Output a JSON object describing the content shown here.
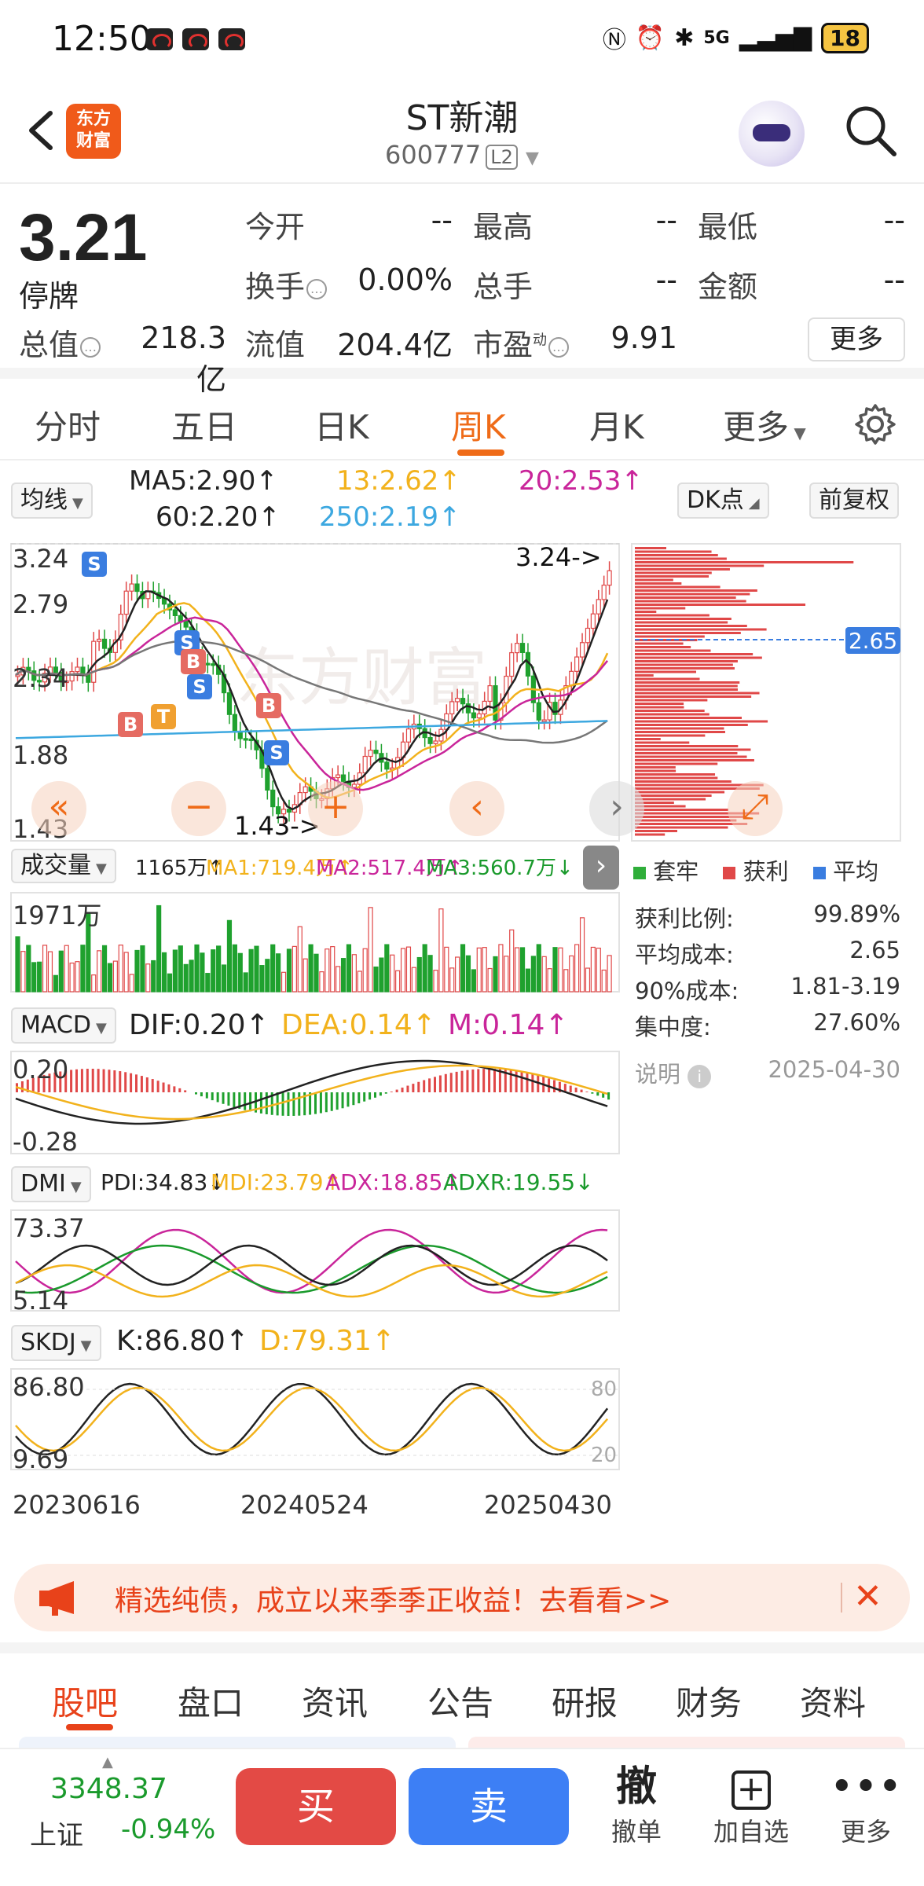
{
  "status_bar": {
    "time": "12:50",
    "network": "5G",
    "battery": "18"
  },
  "header": {
    "logo_line1": "东方",
    "logo_line2": "财富",
    "stock_name": "ST新潮",
    "stock_code": "600777",
    "level_badge": "L2"
  },
  "quote": {
    "price": "3.21",
    "status": "停牌",
    "open_label": "今开",
    "open_value": "--",
    "high_label": "最高",
    "high_value": "--",
    "low_label": "最低",
    "low_value": "--",
    "turnover_label": "换手",
    "turnover_value": "0.00%",
    "volume_label": "总手",
    "volume_value": "--",
    "amount_label": "金额",
    "amount_value": "--",
    "mktcap_label": "总值",
    "mktcap_value": "218.3亿",
    "float_label": "流值",
    "float_value": "204.4亿",
    "pe_label": "市盈",
    "pe_sup": "动",
    "pe_value": "9.91",
    "more_label": "更多"
  },
  "kline_tabs": [
    "分时",
    "五日",
    "日K",
    "周K",
    "月K",
    "更多"
  ],
  "kline_active": "周K",
  "chart": {
    "ma_selector": "均线",
    "ma5": "MA5:2.90↑",
    "ma13": "13:2.62↑",
    "ma20": "20:2.53↑",
    "ma60": "60:2.20↑",
    "ma250": "250:2.19↑",
    "dk_selector": "DK点",
    "adjust_selector": "前复权",
    "price_ticks": [
      "3.24",
      "2.79",
      "2.34",
      "1.88",
      "1.43"
    ],
    "high_mark": "3.24->",
    "low_mark": "1.43->",
    "cost_line_label": "2.65",
    "bs_marks": [
      "S",
      "S",
      "B",
      "S",
      "B",
      "T",
      "B",
      "S"
    ],
    "volume_selector": "成交量",
    "vol_legend": "1165万↑",
    "vol_ma1": "MA1:719.4万↑",
    "vol_ma2": "MA2:517.4万↑",
    "vol_ma3": "MA3:560.7万↓",
    "vol_tick": "1971万",
    "macd_selector": "MACD",
    "macd_dif": "DIF:0.20↑",
    "macd_dea": "DEA:0.14↑",
    "macd_m": "M:0.14↑",
    "macd_ticks": [
      "0.20",
      "-0.28"
    ],
    "dmi_selector": "DMI",
    "dmi_pdi": "PDI:34.83↓",
    "dmi_mdi": "MDI:23.79↑",
    "dmi_adx": "ADX:18.85↑",
    "dmi_adxr": "ADXR:19.55↓",
    "dmi_ticks": [
      "73.37",
      "5.14"
    ],
    "skdj_selector": "SKDJ",
    "skdj_k": "K:86.80↑",
    "skdj_d": "D:79.31↑",
    "skdj_ticks": [
      "86.80",
      "9.69"
    ],
    "skdj_guides": [
      "80",
      "20"
    ],
    "dates": [
      "20230616",
      "20240524",
      "20250430"
    ]
  },
  "chip_panel": {
    "legend": [
      "套牢",
      "获利",
      "平均"
    ],
    "legend_colors": [
      "#2fae3a",
      "#e04848",
      "#3a7de0"
    ],
    "rows": [
      {
        "label": "获利比例:",
        "value": "99.89%"
      },
      {
        "label": "平均成本:",
        "value": "2.65"
      },
      {
        "label": "90%成本:",
        "value": "1.81-3.19"
      },
      {
        "label": "集中度:",
        "value": "27.60%"
      }
    ],
    "note_label": "说明",
    "note_date": "2025-04-30"
  },
  "banner": {
    "text": "精选纯债，成立以来季季正收益！去看看>>"
  },
  "bottom_tabs": [
    "股吧",
    "盘口",
    "资讯",
    "公告",
    "研报",
    "财务",
    "资料"
  ],
  "bottom_active": "股吧",
  "bottom_bar": {
    "index_value": "3348.37",
    "index_name": "上证",
    "index_change": "-0.94%",
    "buy": "买",
    "sell": "卖",
    "cancel_icon": "撤",
    "cancel_label": "撤单",
    "add_label": "加自选",
    "more_label": "更多"
  },
  "colors": {
    "up": "#e04848",
    "down": "#1fa12e",
    "accent": "#ef6b18"
  }
}
